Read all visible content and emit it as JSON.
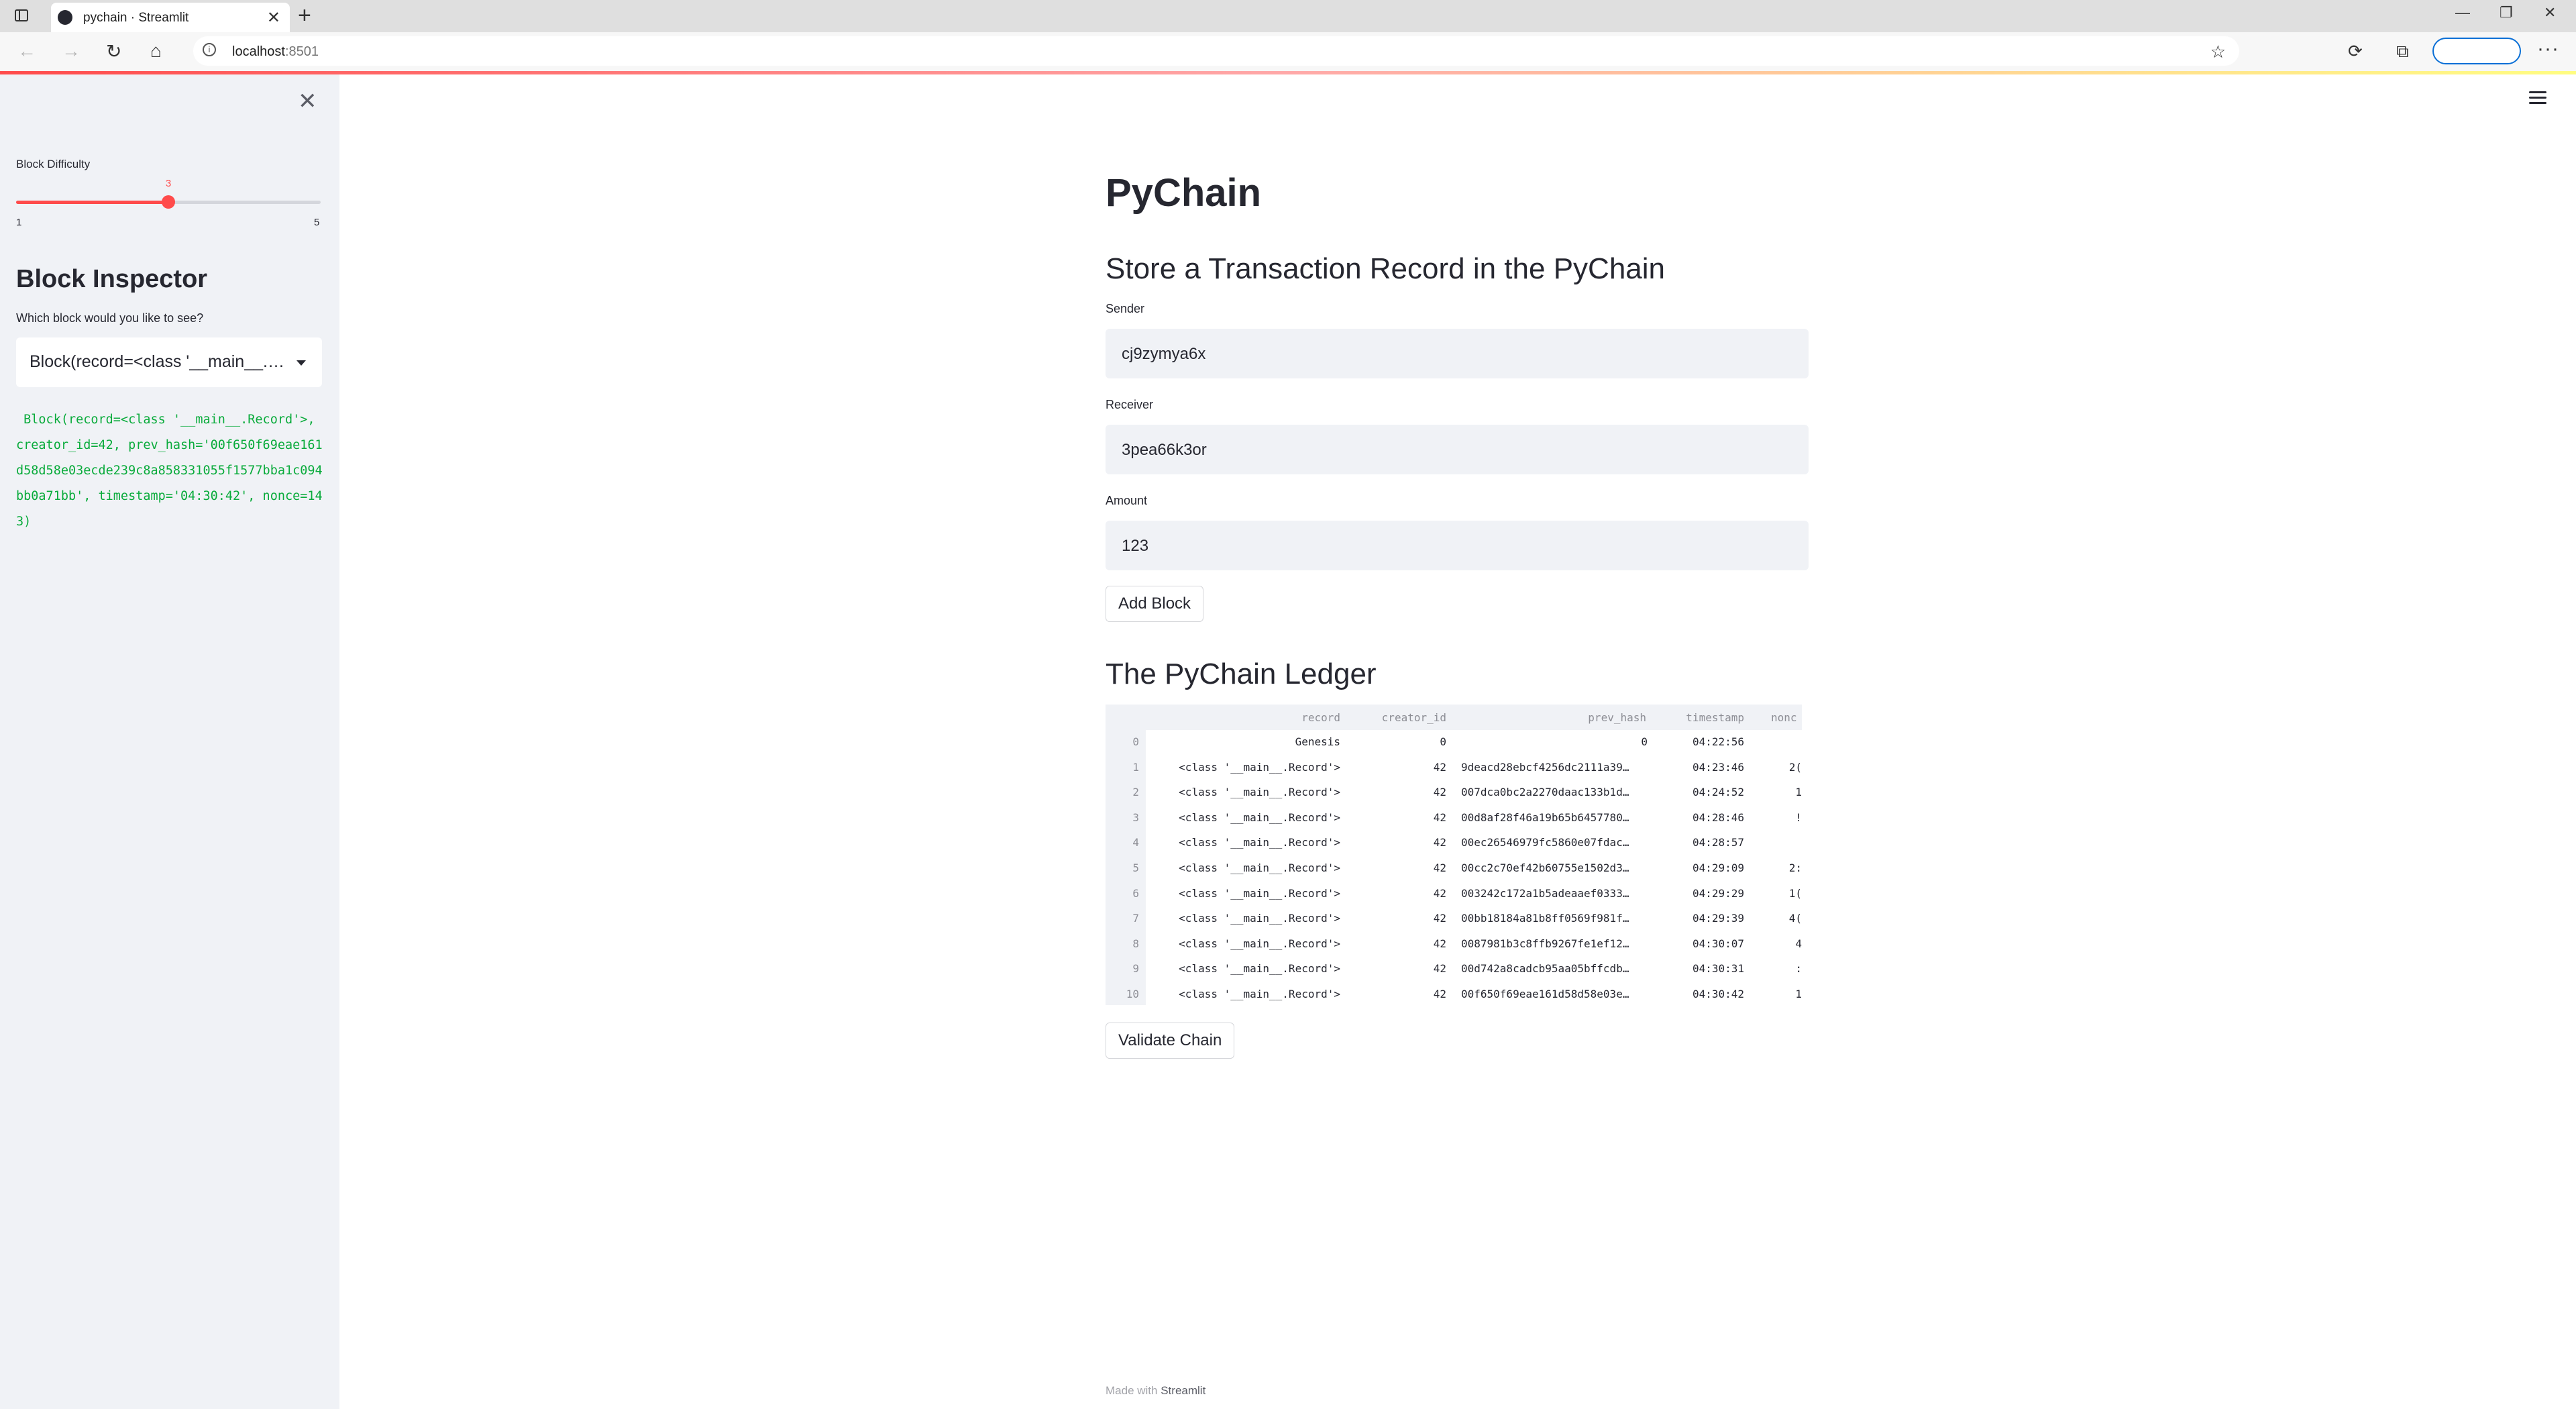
{
  "browser": {
    "tab_title": "pychain · Streamlit",
    "url_host": "localhost",
    "url_port": ":8501"
  },
  "sidebar": {
    "slider_label": "Block Difficulty",
    "slider_value": "3",
    "slider_min": "1",
    "slider_max": "5",
    "slider_fraction": 0.5,
    "header": "Block Inspector",
    "question": "Which block would you like to see?",
    "select_value": "Block(record=<class '__main__.R...",
    "block_code": " Block(record=<class '__main__.Record'>, creator_id=42, prev_hash='00f650f69eae161d58d58e03ecde239c8a858331055f1577bba1c094bb0a71bb', timestamp='04:30:42', nonce=143)"
  },
  "main": {
    "title": "PyChain",
    "subtitle": "Store a Transaction Record in the PyChain",
    "sender_label": "Sender",
    "sender_value": "cj9zymya6x",
    "receiver_label": "Receiver",
    "receiver_value": "3pea66k3or",
    "amount_label": "Amount",
    "amount_value": "123",
    "add_button": "Add Block",
    "ledger_title": "The PyChain Ledger",
    "validate_button": "Validate Chain"
  },
  "ledger": {
    "columns": [
      "record",
      "creator_id",
      "prev_hash",
      "timestamp",
      "nonc"
    ],
    "rows": [
      {
        "idx": "0",
        "record": "Genesis",
        "creator_id": "0",
        "prev_hash": "0",
        "timestamp": "04:22:56",
        "nonce": ""
      },
      {
        "idx": "1",
        "record": "<class '__main__.Record'>",
        "creator_id": "42",
        "prev_hash": "9deacd28ebcf4256dc2111a39…",
        "timestamp": "04:23:46",
        "nonce": "2("
      },
      {
        "idx": "2",
        "record": "<class '__main__.Record'>",
        "creator_id": "42",
        "prev_hash": "007dca0bc2a2270daac133b1d…",
        "timestamp": "04:24:52",
        "nonce": "1"
      },
      {
        "idx": "3",
        "record": "<class '__main__.Record'>",
        "creator_id": "42",
        "prev_hash": "00d8af28f46a19b65b6457780…",
        "timestamp": "04:28:46",
        "nonce": "!"
      },
      {
        "idx": "4",
        "record": "<class '__main__.Record'>",
        "creator_id": "42",
        "prev_hash": "00ec26546979fc5860e07fdac…",
        "timestamp": "04:28:57",
        "nonce": ""
      },
      {
        "idx": "5",
        "record": "<class '__main__.Record'>",
        "creator_id": "42",
        "prev_hash": "00cc2c70ef42b60755e1502d3…",
        "timestamp": "04:29:09",
        "nonce": "2:"
      },
      {
        "idx": "6",
        "record": "<class '__main__.Record'>",
        "creator_id": "42",
        "prev_hash": "003242c172a1b5adeaaef0333…",
        "timestamp": "04:29:29",
        "nonce": "1("
      },
      {
        "idx": "7",
        "record": "<class '__main__.Record'>",
        "creator_id": "42",
        "prev_hash": "00bb18184a81b8ff0569f981f…",
        "timestamp": "04:29:39",
        "nonce": "4("
      },
      {
        "idx": "8",
        "record": "<class '__main__.Record'>",
        "creator_id": "42",
        "prev_hash": "0087981b3c8ffb9267fe1ef12…",
        "timestamp": "04:30:07",
        "nonce": "4"
      },
      {
        "idx": "9",
        "record": "<class '__main__.Record'>",
        "creator_id": "42",
        "prev_hash": "00d742a8cadcb95aa05bffcdb…",
        "timestamp": "04:30:31",
        "nonce": ":"
      },
      {
        "idx": "10",
        "record": "<class '__main__.Record'>",
        "creator_id": "42",
        "prev_hash": "00f650f69eae161d58d58e03e…",
        "timestamp": "04:30:42",
        "nonce": "1"
      }
    ]
  },
  "footer": {
    "made_with": "Made with",
    "brand": "Streamlit"
  },
  "colors": {
    "accent": "#ff4b4b",
    "code_green": "#09ab3b",
    "sidebar_bg": "#f0f2f6"
  }
}
